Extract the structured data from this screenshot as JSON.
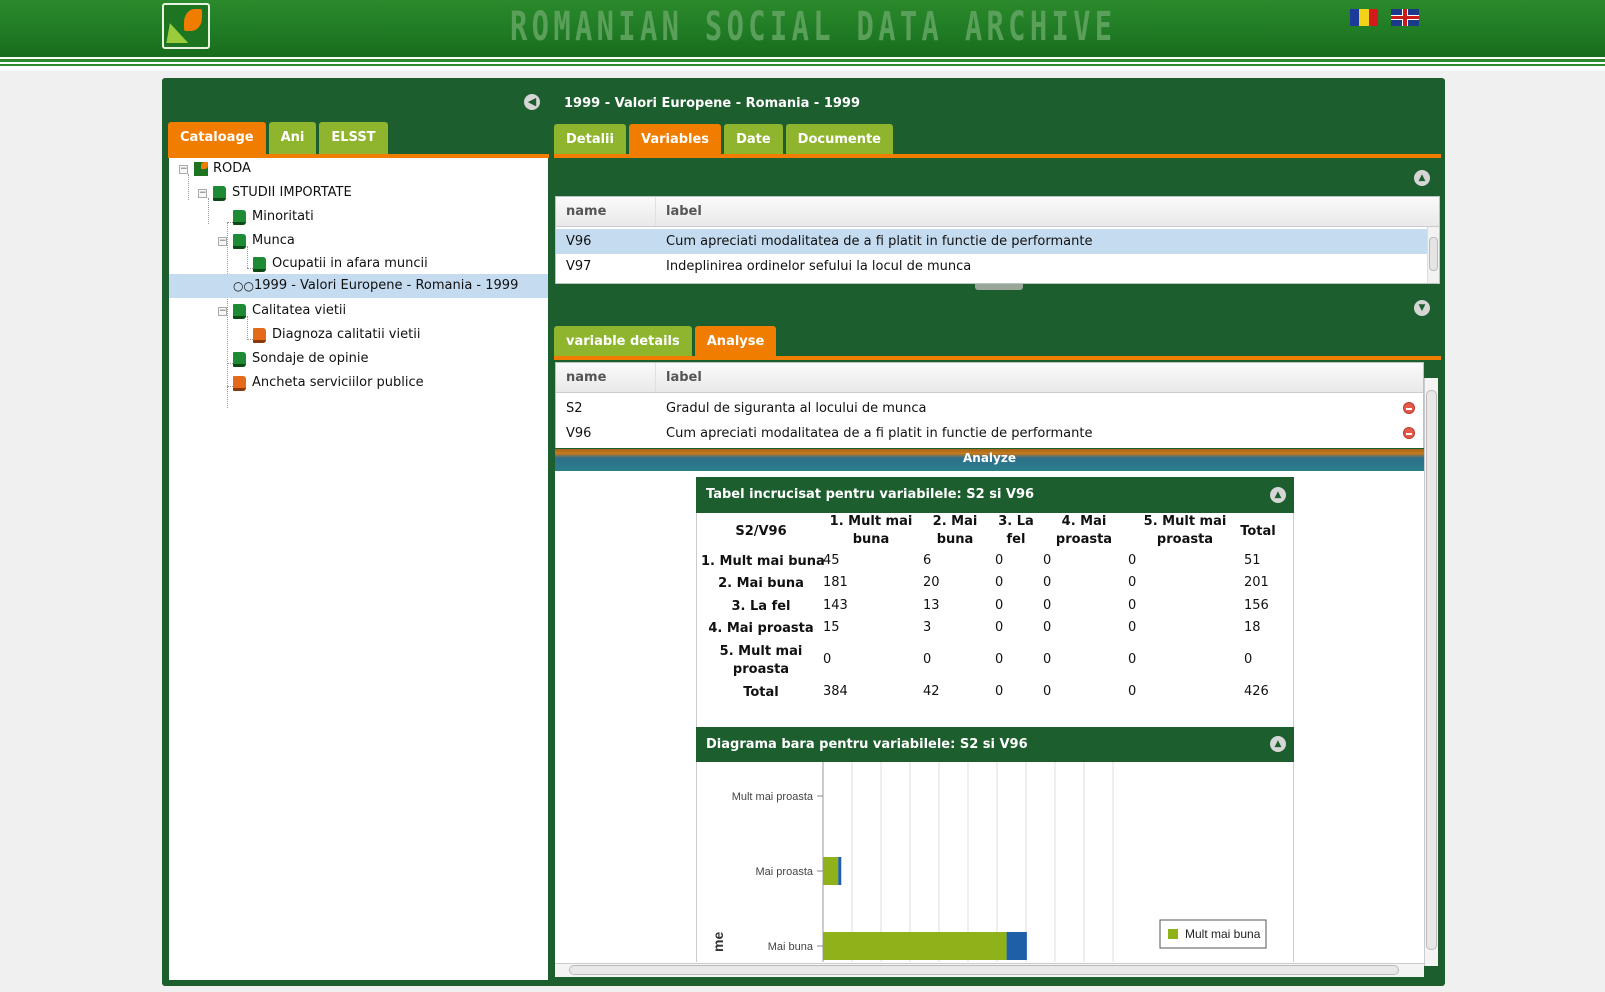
{
  "header": {
    "site_title": "ROMANIAN SOCIAL DATA ARCHIVE",
    "flags": [
      "flag-ro",
      "flag-uk"
    ]
  },
  "left": {
    "tabs": [
      "Cataloage",
      "Ani",
      "ELSST"
    ],
    "active_tab": "Cataloage",
    "tree": [
      {
        "label": "RODA"
      },
      {
        "label": "STUDII IMPORTATE"
      },
      {
        "label": "Minoritati"
      },
      {
        "label": "Munca"
      },
      {
        "label": "Ocupatii in afara muncii"
      },
      {
        "label": "1999 - Valori Europene - Romania - 1999"
      },
      {
        "label": "Calitatea vietii"
      },
      {
        "label": "Diagnoza calitatii vietii"
      },
      {
        "label": "Sondaje de opinie"
      },
      {
        "label": "Ancheta serviciilor publice"
      }
    ]
  },
  "study": {
    "title": "1999 - Valori Europene - Romania - 1999",
    "tabs": [
      "Detalii",
      "Variables",
      "Date",
      "Documente"
    ],
    "active_tab": "Variables"
  },
  "variables_grid": {
    "headers": [
      "name",
      "label"
    ],
    "rows": [
      {
        "name": "V96",
        "label": "Cum apreciati modalitatea de a fi platit in functie de performante"
      },
      {
        "name": "V97",
        "label": "Indeplinirea ordinelor sefului la locul de munca"
      }
    ]
  },
  "details": {
    "tabs": [
      "variable details",
      "Analyse"
    ],
    "active_tab": "Analyse"
  },
  "analyse_grid": {
    "headers": [
      "name",
      "label"
    ],
    "rows": [
      {
        "name": "S2",
        "label": "Gradul de siguranta al locului de munca"
      },
      {
        "name": "V96",
        "label": "Cum apreciati modalitatea de a fi platit in functie de performante"
      }
    ],
    "analyze_label": "Analyze"
  },
  "crosstab": {
    "title": "Tabel incrucisat pentru variabilele: S2 si V96",
    "corner": "S2/V96",
    "col_headers": [
      "1. Mult mai\nbuna",
      "2. Mai\nbuna",
      "3. La\nfel",
      "4. Mai\nproasta",
      "5. Mult mai\nproasta",
      "Total"
    ],
    "rows": [
      {
        "label": "1. Mult mai buna",
        "values": [
          "45",
          "6",
          "0",
          "0",
          "0",
          "51"
        ]
      },
      {
        "label": "2. Mai buna",
        "values": [
          "181",
          "20",
          "0",
          "0",
          "0",
          "201"
        ]
      },
      {
        "label": "3. La fel",
        "values": [
          "143",
          "13",
          "0",
          "0",
          "0",
          "156"
        ]
      },
      {
        "label": "4. Mai proasta",
        "values": [
          "15",
          "3",
          "0",
          "0",
          "0",
          "18"
        ]
      },
      {
        "label": "5. Mult mai\nproasta",
        "values": [
          "0",
          "0",
          "0",
          "0",
          "0",
          "0"
        ]
      },
      {
        "label": "Total",
        "values": [
          "384",
          "42",
          "0",
          "0",
          "0",
          "426"
        ]
      }
    ]
  },
  "bar_chart_panel": {
    "title": "Diagrama bara pentru variabilele: S2 si V96"
  },
  "chart_data": {
    "type": "bar",
    "orientation": "horizontal",
    "stacked": true,
    "categories": [
      "Mult mai proasta",
      "Mai proasta",
      "Mai buna"
    ],
    "series": [
      {
        "name": "Mult mai buna",
        "values": [
          0,
          15,
          181
        ],
        "color": "#8fb21a"
      },
      {
        "values": [
          0,
          3,
          20
        ],
        "color": "#1f5fa8"
      }
    ],
    "xlim": [
      0,
      280
    ],
    "ylabel_partial": "me",
    "grid": true,
    "legend": "bottom-right"
  },
  "colors": {
    "frame": "#1d5e2e",
    "tab_active": "#f07c00",
    "tab_inactive": "#8fb52f",
    "selection": "#c5dcf0"
  }
}
